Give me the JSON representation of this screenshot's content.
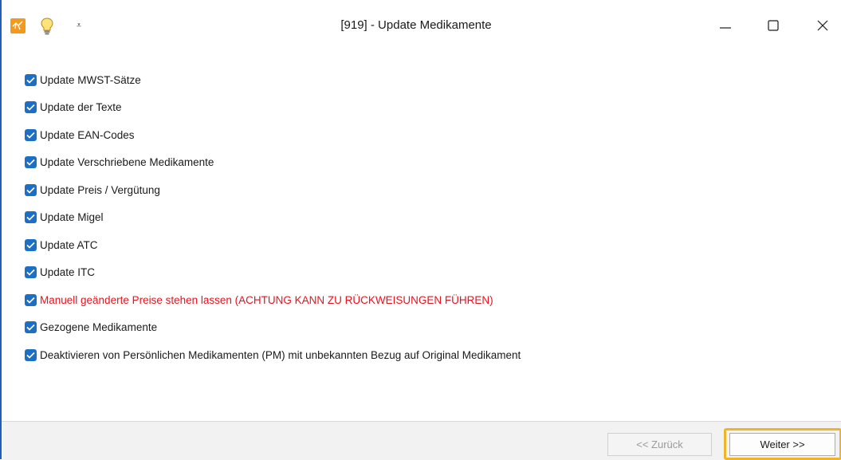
{
  "window": {
    "title": "[919] - Update Medikamente",
    "qa_glyph": "⩡"
  },
  "options": [
    {
      "label": "Update MWST-Sätze",
      "checked": true,
      "warning": false
    },
    {
      "label": "Update der Texte",
      "checked": true,
      "warning": false
    },
    {
      "label": "Update EAN-Codes",
      "checked": true,
      "warning": false
    },
    {
      "label": "Update Verschriebene Medikamente",
      "checked": true,
      "warning": false
    },
    {
      "label": "Update Preis / Vergütung",
      "checked": true,
      "warning": false
    },
    {
      "label": "Update Migel",
      "checked": true,
      "warning": false
    },
    {
      "label": "Update ATC",
      "checked": true,
      "warning": false
    },
    {
      "label": "Update ITC",
      "checked": true,
      "warning": false
    },
    {
      "label": "Manuell geänderte Preise stehen lassen (ACHTUNG KANN ZU RÜCKWEISUNGEN FÜHREN)",
      "checked": true,
      "warning": true
    },
    {
      "label": "Gezogene Medikamente",
      "checked": true,
      "warning": false
    },
    {
      "label": "Deaktivieren von Persönlichen Medikamenten (PM) mit unbekannten Bezug auf Original Medikament",
      "checked": true,
      "warning": false
    }
  ],
  "footer": {
    "back_label": "<< Zurück",
    "next_label": "Weiter >>"
  },
  "colors": {
    "accent": "#1d6fc5",
    "warning": "#e8121e",
    "highlight": "#f0b429",
    "app_icon": "#f39a1e"
  }
}
